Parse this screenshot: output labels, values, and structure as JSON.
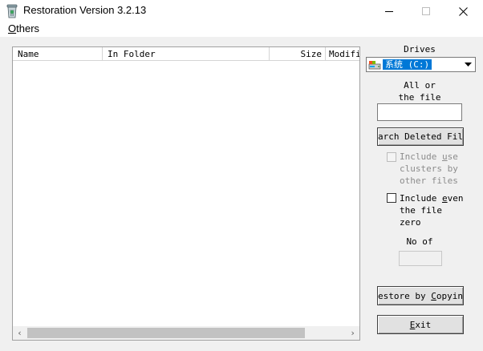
{
  "window": {
    "title": "Restoration Version 3.2.13",
    "icon": "recycle-bin-icon"
  },
  "menu": {
    "items": [
      {
        "label_prefix": "O",
        "label_rest": "thers"
      }
    ]
  },
  "file_list": {
    "columns": [
      {
        "label": "Name"
      },
      {
        "label": "In Folder"
      },
      {
        "label": "Size"
      },
      {
        "label": "Modifi"
      }
    ],
    "rows": []
  },
  "drives": {
    "label": "Drives",
    "selected": "系统 (C:)",
    "icon": "hard-drive-icon"
  },
  "search": {
    "label_line1": "All or",
    "label_line2": "the file",
    "value": "",
    "button_label": "earch Deleted File"
  },
  "options": {
    "include_used": {
      "pre": "Include ",
      "accel": "u",
      "post": "se\nclusters by\nother files",
      "checked": false,
      "enabled": false
    },
    "include_zero": {
      "pre": "Include ",
      "accel": "e",
      "post": "ven\nthe file\nzero",
      "checked": false,
      "enabled": true
    }
  },
  "count": {
    "label": "No of",
    "value": ""
  },
  "actions": {
    "restore": {
      "pre": "Restore by ",
      "accel": "C",
      "post": "opying"
    },
    "exit": {
      "accel": "E",
      "post": "xit"
    }
  },
  "colors": {
    "selection": "#0078d7",
    "client_bg": "#f0f0f0",
    "button_face": "#e1e1e1"
  }
}
